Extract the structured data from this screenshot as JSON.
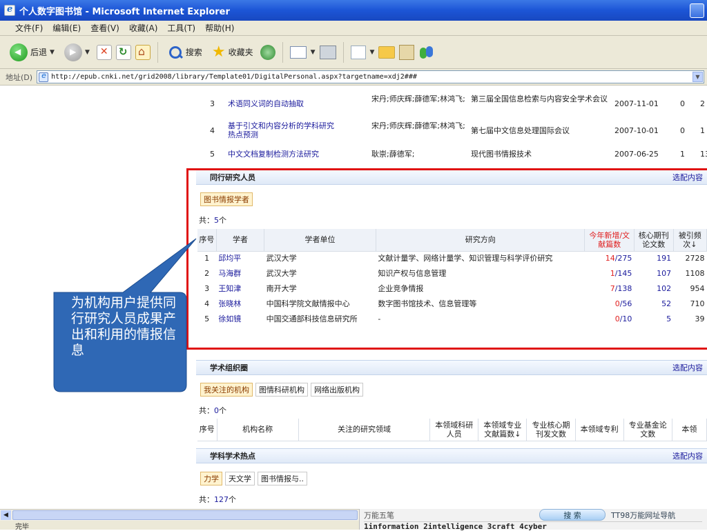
{
  "window": {
    "title": "个人数字图书馆 - Microsoft Internet Explorer"
  },
  "menu": [
    "文件(F)",
    "编辑(E)",
    "查看(V)",
    "收藏(A)",
    "工具(T)",
    "帮助(H)"
  ],
  "toolbar": {
    "back_label": "后退",
    "search_label": "搜索",
    "favorites_label": "收藏夹",
    "icons": [
      "back-icon",
      "forward-icon",
      "stop-icon",
      "refresh-icon",
      "home-icon",
      "search-icon",
      "star-icon",
      "media-icon",
      "mail-icon",
      "print-icon",
      "edit-icon",
      "folder-icon",
      "research-icon",
      "messenger-icon"
    ]
  },
  "address": {
    "label": "地址(D)",
    "url": "http://epub.cnki.net/grid2008/library/Template01/DigitalPersonal.aspx?targetname=xdj2###"
  },
  "papers": [
    {
      "num": "3",
      "title": "术语同义词的自动抽取",
      "authors": "宋丹;师庆辉;薛德军;林鸿飞;",
      "venue": "第三届全国信息检索与内容安全学术会议",
      "date": "2007-11-01",
      "c1": "0",
      "c2": "2"
    },
    {
      "num": "4",
      "title": "基于引文和内容分析的学科研究热点预测",
      "authors": "宋丹;师庆辉;薛德军;林鸿飞;",
      "venue": "第七届中文信息处理国际会议",
      "date": "2007-10-01",
      "c1": "0",
      "c2": "1"
    },
    {
      "num": "5",
      "title": "中文文档复制检测方法研究",
      "authors": "耿崇;薛德军;",
      "venue": "现代图书情报技术",
      "date": "2007-06-25",
      "c1": "1",
      "c2": "13"
    }
  ],
  "peers": {
    "title": "同行研究人员",
    "config": "选配内容",
    "tab": "图书情报学者",
    "count_prefix": "共：",
    "count": "5",
    "count_suffix": "个",
    "headers": [
      "序号",
      "学者",
      "学者单位",
      "研究方向",
      "今年新增/文献篇数",
      "核心期刊论文数",
      "被引频次↓"
    ],
    "rows": [
      {
        "num": "1",
        "name": "邱均平",
        "unit": "武汉大学",
        "dir": "文献计量学、网络计量学、知识管理与科学评价研究",
        "new": "14",
        "total": "/275",
        "core": "191",
        "cited": "2728"
      },
      {
        "num": "2",
        "name": "马海群",
        "unit": "武汉大学",
        "dir": "知识产权与信息管理",
        "new": "1",
        "total": "/145",
        "core": "107",
        "cited": "1108"
      },
      {
        "num": "3",
        "name": "王知津",
        "unit": "南开大学",
        "dir": "企业竞争情报",
        "new": "7",
        "total": "/138",
        "core": "102",
        "cited": "954"
      },
      {
        "num": "4",
        "name": "张晓林",
        "unit": "中国科学院文献情报中心",
        "dir": "数字图书馆技术、信息管理等",
        "new": "0",
        "total": "/56",
        "core": "52",
        "cited": "710"
      },
      {
        "num": "5",
        "name": "徐如镜",
        "unit": "中国交通部科技信息研究所",
        "dir": "-",
        "new": "0",
        "total": "/10",
        "core": "5",
        "cited": "39"
      }
    ]
  },
  "orgs": {
    "title": "学术组织圈",
    "config": "选配内容",
    "tabs": [
      "我关注的机构",
      "图情科研机构",
      "网络出版机构"
    ],
    "count_prefix": "共：",
    "count": "0",
    "count_suffix": "个",
    "headers": [
      "序号",
      "机构名称",
      "关注的研究领域",
      "本领域科研人员",
      "本领域专业文献篇数↓",
      "专业核心期刊发文数",
      "本领域专利",
      "专业基金论文数",
      "本领"
    ]
  },
  "hotspots": {
    "title": "学科学术热点",
    "config": "选配内容",
    "tabs": [
      "力学",
      "天文学",
      "图书情报与.."
    ],
    "count_prefix": "共：",
    "count": "127",
    "count_suffix": "个"
  },
  "callout": {
    "text": "为机构用户提供同行研究人员成果产出和利用的情报信息"
  },
  "status": {
    "text": "完毕"
  },
  "ime": {
    "name": "万能五笔",
    "search": "搜 索",
    "nav": "TT98万能网址导航",
    "code": "1information 2intelligence 3craft 4cyber"
  },
  "colors": {
    "accent_red": "#e01010",
    "callout_blue": "#2f68b5",
    "link_blue": "#1a1a9c"
  }
}
